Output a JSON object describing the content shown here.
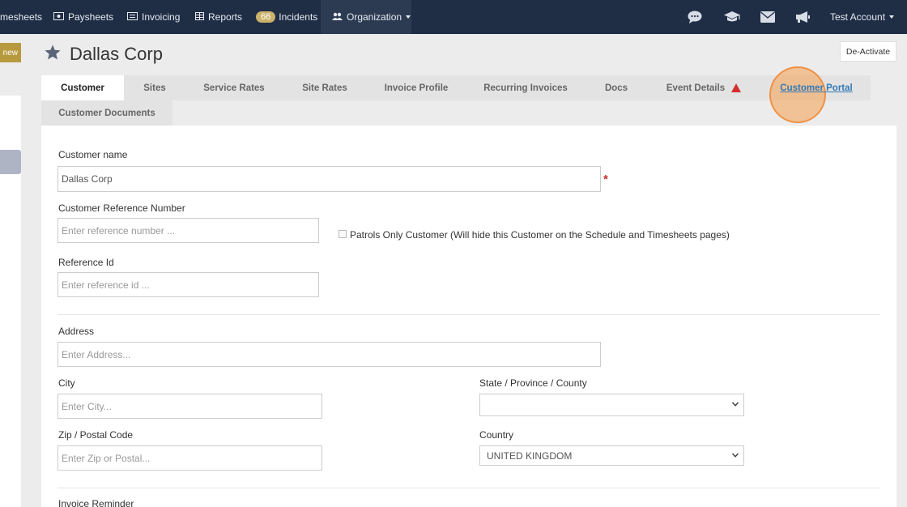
{
  "nav": {
    "timesheets": "mesheets",
    "paysheets": "Paysheets",
    "invoicing": "Invoicing",
    "reports": "Reports",
    "incidents_badge": "66",
    "incidents": "Incidents",
    "organization": "Organization",
    "account": "Test Account",
    "icons": [
      "chat-icon",
      "graduation-cap-icon",
      "envelope-icon",
      "megaphone-icon"
    ]
  },
  "sidebar": {
    "new_label": "new"
  },
  "header": {
    "title": "Dallas Corp",
    "deactivate": "De-Activate"
  },
  "tabs": [
    "Customer",
    "Sites",
    "Service Rates",
    "Site Rates",
    "Invoice Profile",
    "Recurring Invoices",
    "Docs",
    "Event Details",
    "Customer Portal",
    "Customer Documents"
  ],
  "form": {
    "customer_name_label": "Customer name",
    "customer_name_value": "Dallas Corp",
    "required_mark": "*",
    "ref_number_label": "Customer Reference Number",
    "ref_number_placeholder": "Enter reference number ...",
    "patrols_label": "Patrols Only Customer (Will hide this Customer on the Schedule and Timesheets pages)",
    "ref_id_label": "Reference Id",
    "ref_id_placeholder": "Enter reference id ...",
    "address_label": "Address",
    "address_placeholder": "Enter Address...",
    "city_label": "City",
    "city_placeholder": "Enter City...",
    "state_label": "State / Province / County",
    "state_value": "",
    "zip_label": "Zip / Postal Code",
    "zip_placeholder": "Enter Zip or Postal...",
    "country_label": "Country",
    "country_value": "UNITED KINGDOM",
    "invoice_reminder_label": "Invoice Reminder"
  },
  "colors": {
    "nav_bg": "#1f2d45",
    "accent_gold": "#b89a3e",
    "link_blue": "#337ab7",
    "warning_red": "#d32f2f",
    "highlight_orange": "#f5a050"
  }
}
